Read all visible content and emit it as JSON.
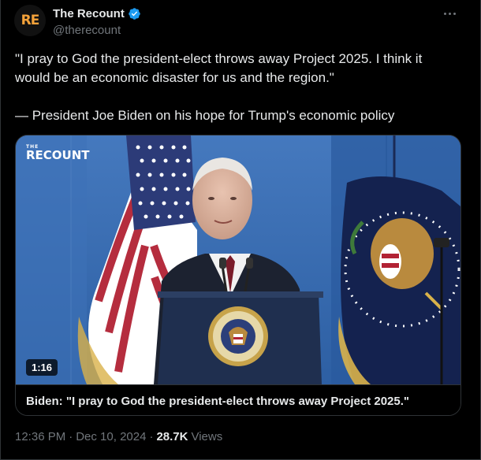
{
  "author": {
    "avatar_text": "RE",
    "display_name": "The Recount",
    "handle": "@therecount",
    "verified": true
  },
  "tweet": {
    "text_line_1": "\"I pray to God the president-elect throws away Project 2025. I think it",
    "text_line_2": "would be an economic disaster for us and the region.\"",
    "text_line_3": "— President Joe Biden on his hope for Trump's economic policy"
  },
  "media": {
    "watermark_small": "THE",
    "watermark": "RECOUNT",
    "duration": "1:16",
    "caption": "Biden: \"I pray to God the president-elect throws away Project 2025.\""
  },
  "meta": {
    "time": "12:36 PM",
    "sep1": "·",
    "date": "Dec 10, 2024",
    "sep2": "·",
    "views_count": "28.7K",
    "views_label": "Views"
  },
  "colors": {
    "background": "#000000",
    "text": "#e7e9ea",
    "muted": "#71767b",
    "border": "#2f3336",
    "verified": "#1d9bf0",
    "brand": "#f4a23a"
  },
  "icons": {
    "more": "more-horizontal-icon",
    "verified": "verified-badge-icon"
  }
}
